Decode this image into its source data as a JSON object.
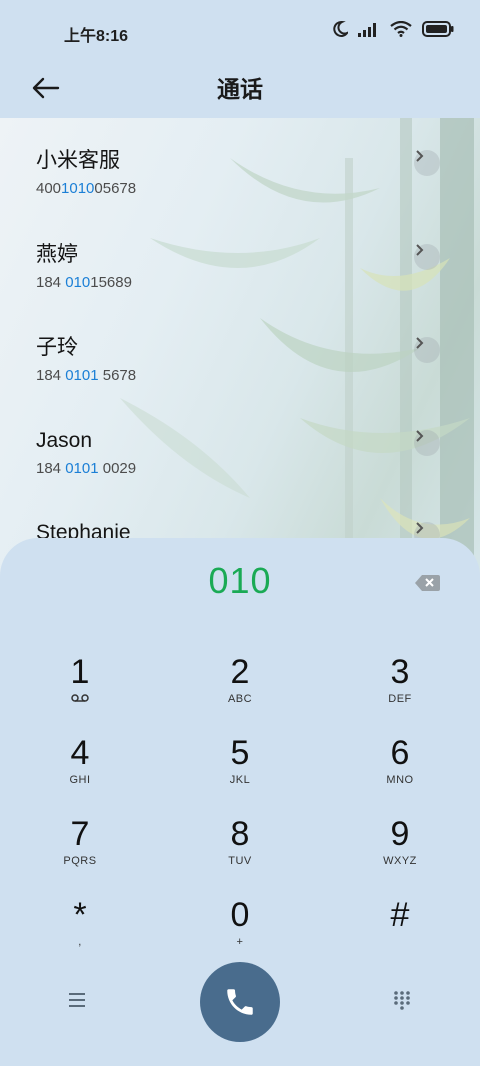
{
  "status": {
    "time": "上午8:16"
  },
  "header": {
    "title": "通话"
  },
  "contacts": [
    {
      "name": "小米客服",
      "num_pre": "400",
      "num_hl": "1010",
      "num_post": "05678"
    },
    {
      "name": "燕婷",
      "num_pre": "184 ",
      "num_hl": "010",
      "num_post": "15689"
    },
    {
      "name": "子玲",
      "num_pre": "184 ",
      "num_hl": "0101",
      "num_post": " 5678"
    },
    {
      "name": "Jason",
      "num_pre": "184 ",
      "num_hl": "0101",
      "num_post": " 0029"
    },
    {
      "name": "Stephanie",
      "num_pre": "",
      "num_hl": "",
      "num_post": ""
    }
  ],
  "dialpad": {
    "input": "010",
    "keys": [
      {
        "digit": "1",
        "letters": ""
      },
      {
        "digit": "2",
        "letters": "ABC"
      },
      {
        "digit": "3",
        "letters": "DEF"
      },
      {
        "digit": "4",
        "letters": "GHI"
      },
      {
        "digit": "5",
        "letters": "JKL"
      },
      {
        "digit": "6",
        "letters": "MNO"
      },
      {
        "digit": "7",
        "letters": "PQRS"
      },
      {
        "digit": "8",
        "letters": "TUV"
      },
      {
        "digit": "9",
        "letters": "WXYZ"
      },
      {
        "digit": "*",
        "letters": ","
      },
      {
        "digit": "0",
        "letters": "+"
      },
      {
        "digit": "#",
        "letters": ""
      }
    ]
  },
  "colors": {
    "accent_green": "#1aaa55",
    "highlight_blue": "#1b7fd6",
    "call_button": "#496c8d",
    "background": "#cfe0f0"
  },
  "icons": {
    "back": "arrow-left-icon",
    "backspace": "backspace-icon",
    "voicemail": "voicemail-icon",
    "menu": "menu-icon",
    "call": "phone-icon",
    "keypad": "keypad-icon"
  }
}
